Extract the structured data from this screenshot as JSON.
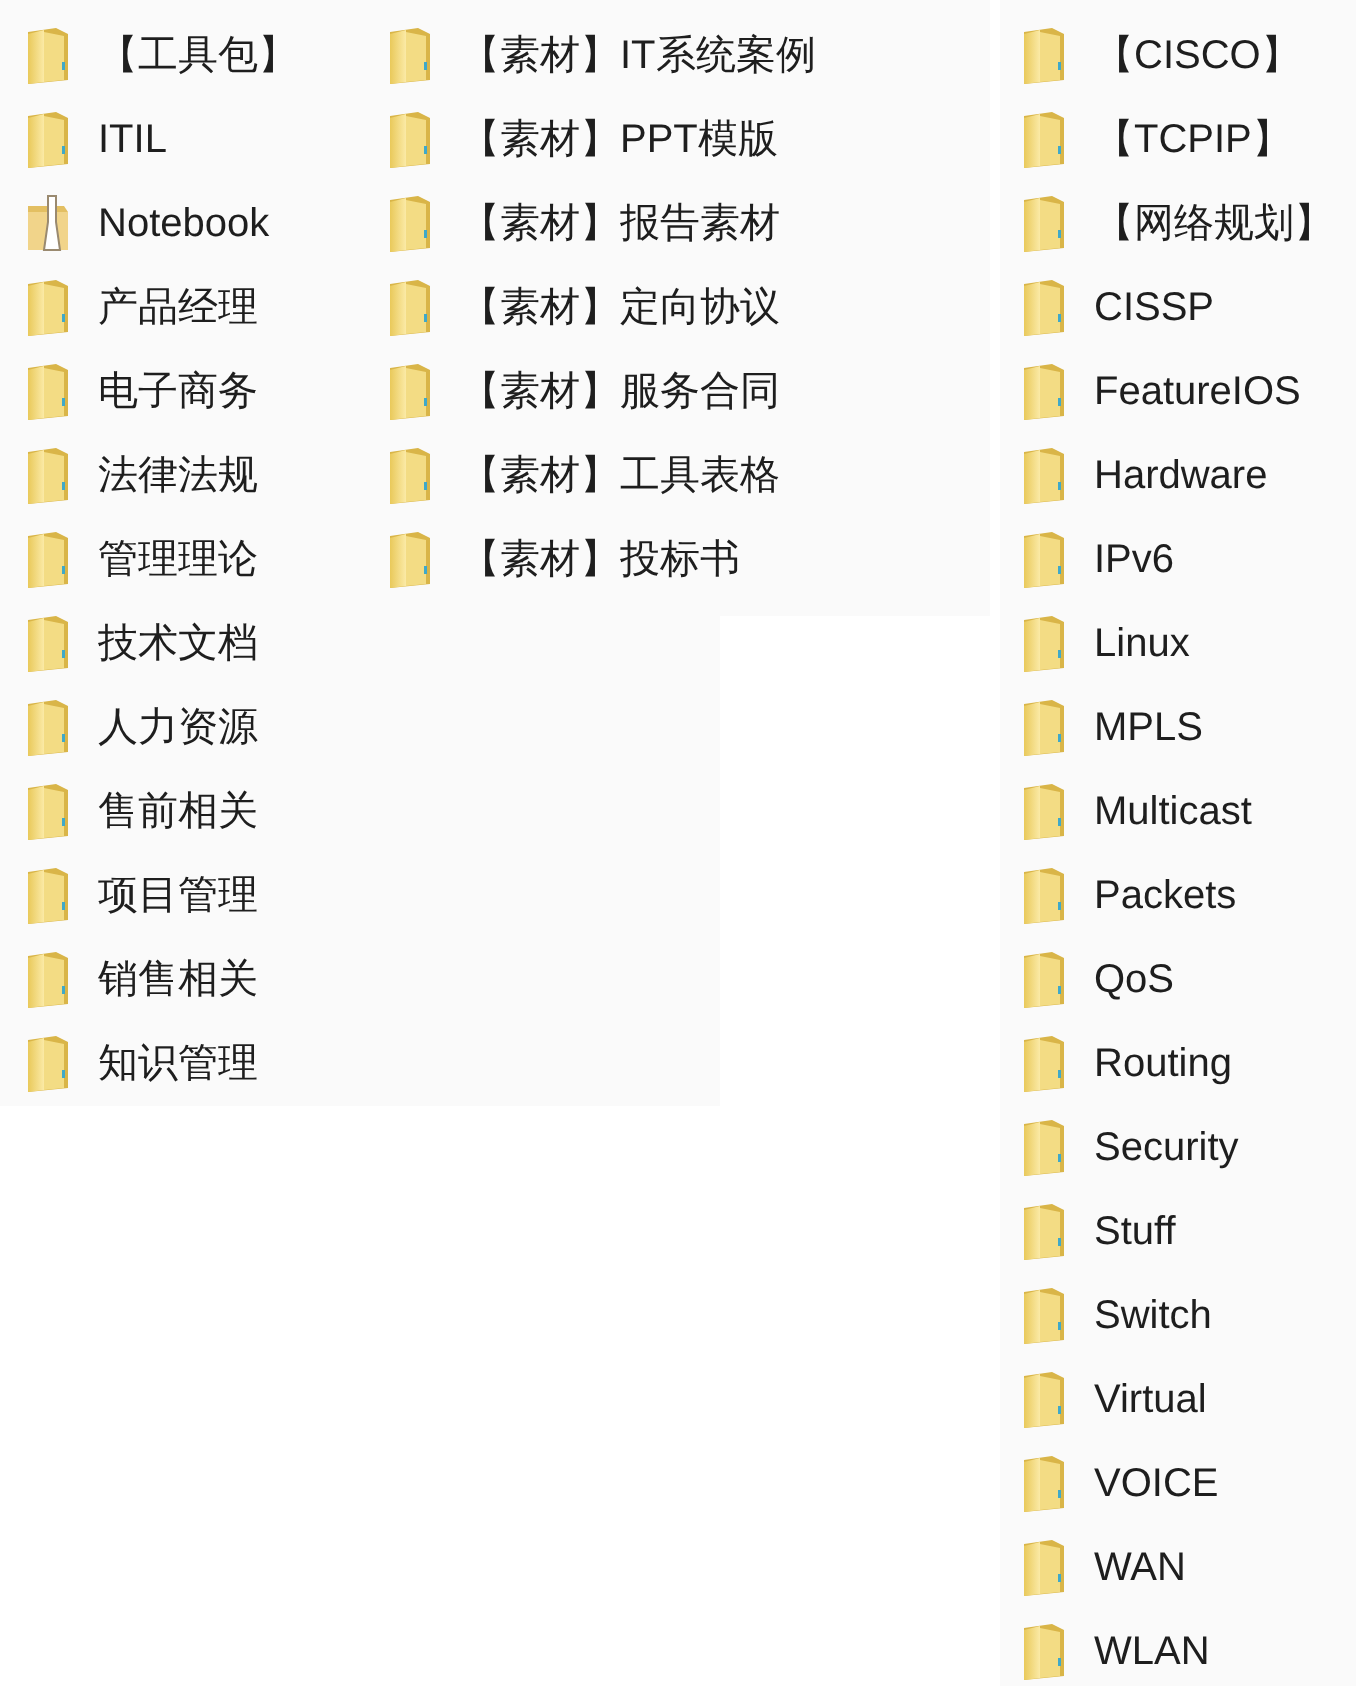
{
  "panels": [
    {
      "items": [
        {
          "label": "【工具包】",
          "kind": "folder"
        },
        {
          "label": "ITIL",
          "kind": "folder"
        },
        {
          "label": "Notebook",
          "kind": "notebook"
        },
        {
          "label": "产品经理",
          "kind": "folder"
        },
        {
          "label": "电子商务",
          "kind": "folder"
        },
        {
          "label": "法律法规",
          "kind": "folder"
        },
        {
          "label": "管理理论",
          "kind": "folder"
        },
        {
          "label": "技术文档",
          "kind": "folder"
        },
        {
          "label": "人力资源",
          "kind": "folder"
        },
        {
          "label": "售前相关",
          "kind": "folder"
        },
        {
          "label": "项目管理",
          "kind": "folder"
        },
        {
          "label": "销售相关",
          "kind": "folder"
        },
        {
          "label": "知识管理",
          "kind": "folder"
        }
      ]
    },
    {
      "items": [
        {
          "label": "【素材】IT系统案例",
          "kind": "folder"
        },
        {
          "label": "【素材】PPT模版",
          "kind": "folder"
        },
        {
          "label": "【素材】报告素材",
          "kind": "folder"
        },
        {
          "label": "【素材】定向协议",
          "kind": "folder"
        },
        {
          "label": "【素材】服务合同",
          "kind": "folder"
        },
        {
          "label": "【素材】工具表格",
          "kind": "folder"
        },
        {
          "label": "【素材】投标书",
          "kind": "folder"
        }
      ]
    },
    {
      "items": [
        {
          "label": "【CISCO】",
          "kind": "folder"
        },
        {
          "label": "【TCPIP】",
          "kind": "folder"
        },
        {
          "label": "【网络规划】",
          "kind": "folder"
        },
        {
          "label": "CISSP",
          "kind": "folder"
        },
        {
          "label": "FeatureIOS",
          "kind": "folder"
        },
        {
          "label": "Hardware",
          "kind": "folder"
        },
        {
          "label": "IPv6",
          "kind": "folder"
        },
        {
          "label": "Linux",
          "kind": "folder"
        },
        {
          "label": "MPLS",
          "kind": "folder"
        },
        {
          "label": "Multicast",
          "kind": "folder"
        },
        {
          "label": "Packets",
          "kind": "folder"
        },
        {
          "label": "QoS",
          "kind": "folder"
        },
        {
          "label": "Routing",
          "kind": "folder"
        },
        {
          "label": "Security",
          "kind": "folder"
        },
        {
          "label": "Stuff",
          "kind": "folder"
        },
        {
          "label": "Switch",
          "kind": "folder"
        },
        {
          "label": "Virtual",
          "kind": "folder"
        },
        {
          "label": "VOICE",
          "kind": "folder"
        },
        {
          "label": "WAN",
          "kind": "folder"
        },
        {
          "label": "WLAN",
          "kind": "folder"
        }
      ]
    }
  ]
}
